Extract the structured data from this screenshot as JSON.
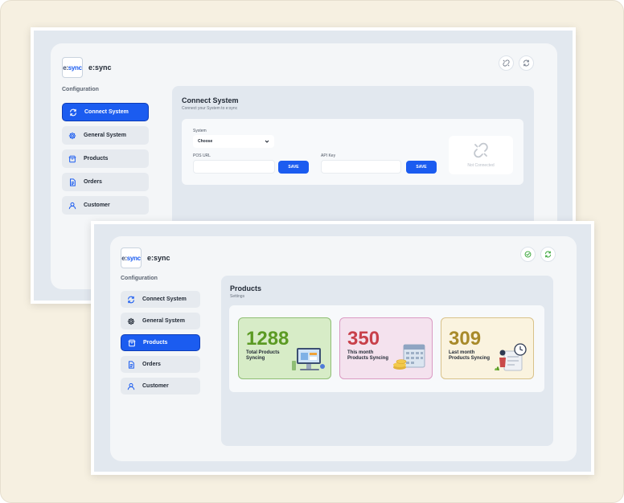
{
  "brand": {
    "logo_text_a": "e:",
    "logo_text_b": "sync",
    "name": "e:sync"
  },
  "sidebar": {
    "heading": "Configuration",
    "items": [
      {
        "label": "Connect System",
        "icon": "sync-icon"
      },
      {
        "label": "General System",
        "icon": "gear-icon"
      },
      {
        "label": "Products",
        "icon": "box-icon"
      },
      {
        "label": "Orders",
        "icon": "document-icon"
      },
      {
        "label": "Customer",
        "icon": "user-icon"
      }
    ]
  },
  "screen1": {
    "active_item": "Connect System",
    "top_icons": [
      "unlink-icon",
      "refresh-icon"
    ],
    "title": "Connect System",
    "subtitle": "Connect your System to e:sync",
    "form": {
      "system_label": "System",
      "system_value": "Choose",
      "pos_url_label": "POS URL",
      "pos_url_value": "",
      "api_key_label": "API Key",
      "api_key_value": "",
      "save_label": "SAVE"
    },
    "status": {
      "text": "Not Connected",
      "icon": "unlink-icon"
    }
  },
  "screen2": {
    "active_item": "Products",
    "top_icons": [
      "check-circle-icon",
      "refresh-icon"
    ],
    "title": "Products",
    "subtitle": "Settings",
    "stats": [
      {
        "value": "1288",
        "label": "Total Products Syncing",
        "color": "#5b9a23",
        "illustration": "computer-illustration"
      },
      {
        "value": "350",
        "label": "This month Products Syncing",
        "color": "#c8404a",
        "illustration": "calendar-illustration"
      },
      {
        "value": "309",
        "label": "Last month Products Syncing",
        "color": "#a88a2a",
        "illustration": "clock-illustration"
      }
    ]
  },
  "colors": {
    "accent": "#1b5cf0",
    "success": "#3aa63a",
    "background": "#f6f0e1"
  }
}
